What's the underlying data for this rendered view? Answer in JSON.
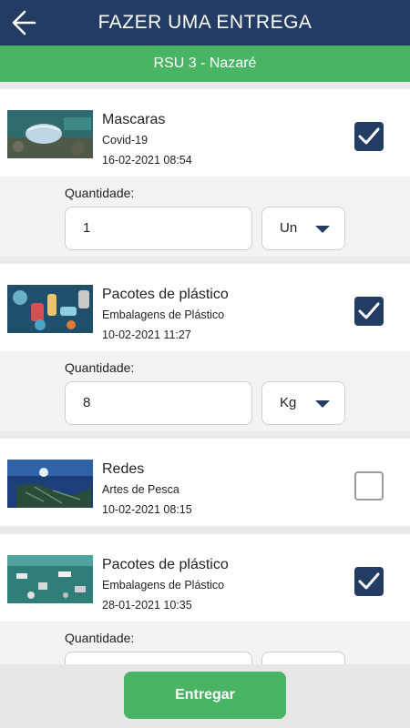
{
  "header": {
    "title": "FAZER UMA ENTREGA",
    "back_icon": "arrow-left-icon"
  },
  "location": "RSU 3 - Nazaré",
  "quantity_label": "Quantidade:",
  "items": [
    {
      "title": "Mascaras",
      "category": "Covid-19",
      "date": "16-02-2021 08:54",
      "checked": true,
      "quantity": "1",
      "unit": "Un"
    },
    {
      "title": "Pacotes de plástico",
      "category": "Embalagens de Plástico",
      "date": "10-02-2021 11:27",
      "checked": true,
      "quantity": "8",
      "unit": "Kg"
    },
    {
      "title": "Redes",
      "category": "Artes de Pesca",
      "date": "10-02-2021 08:15",
      "checked": false
    },
    {
      "title": "Pacotes de plástico",
      "category": "Embalagens de Plástico",
      "date": "28-01-2021 10:35",
      "checked": true,
      "quantity": "",
      "unit": ""
    }
  ],
  "submit_label": "Entregar",
  "colors": {
    "header": "#233c63",
    "accent": "#49b564",
    "checkbox": "#233c63"
  }
}
